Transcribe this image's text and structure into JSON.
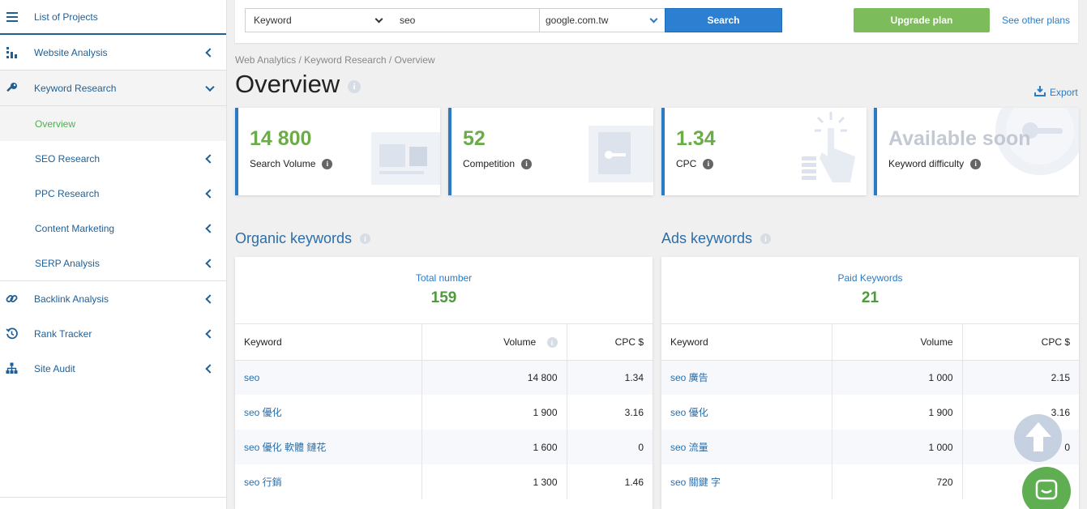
{
  "sidebar": {
    "top_item": {
      "label": "List of Projects",
      "icon": "menu-icon"
    },
    "items": [
      {
        "label": "Website Analysis",
        "icon": "bar-chart-icon"
      },
      {
        "label": "Keyword Research",
        "icon": "key-icon"
      }
    ],
    "sub_items": [
      {
        "label": "Overview"
      },
      {
        "label": "SEO Research"
      },
      {
        "label": "PPC Research"
      },
      {
        "label": "Content Marketing"
      },
      {
        "label": "SERP Analysis"
      }
    ],
    "bottom_items": [
      {
        "label": "Backlink Analysis",
        "icon": "link-icon"
      },
      {
        "label": "Rank Tracker",
        "icon": "history-icon"
      },
      {
        "label": "Site Audit",
        "icon": "sitemap-icon"
      }
    ]
  },
  "search": {
    "type_value": "Keyword",
    "query_value": "seo",
    "engine_value": "google.com.tw",
    "search_label": "Search",
    "upgrade_label": "Upgrade plan",
    "plans_label": "See other plans"
  },
  "breadcrumb": "Web Analytics / Keyword Research / Overview",
  "page_title": "Overview",
  "export_label": "Export",
  "metrics": [
    {
      "value": "14 800",
      "label": "Search Volume"
    },
    {
      "value": "52",
      "label": "Competition"
    },
    {
      "value": "1.34",
      "label": "CPC"
    },
    {
      "value": "Available soon",
      "label": "Keyword difficulty"
    }
  ],
  "organic": {
    "title": "Organic keywords",
    "total_label": "Total number",
    "total_value": "159",
    "columns": [
      "Keyword",
      "Volume",
      "CPC $"
    ],
    "rows": [
      {
        "keyword": "seo",
        "volume": "14 800",
        "cpc": "1.34"
      },
      {
        "keyword": "seo 優化",
        "volume": "1 900",
        "cpc": "3.16"
      },
      {
        "keyword": "seo 優化 軟體 鏈花",
        "volume": "1 600",
        "cpc": "0"
      },
      {
        "keyword": "seo 行銷",
        "volume": "1 300",
        "cpc": "1.46"
      }
    ]
  },
  "ads": {
    "title": "Ads keywords",
    "total_label": "Paid Keywords",
    "total_value": "21",
    "columns": [
      "Keyword",
      "Volume",
      "CPC $"
    ],
    "rows": [
      {
        "keyword": "seo 廣告",
        "volume": "1 000",
        "cpc": "2.15"
      },
      {
        "keyword": "seo 優化",
        "volume": "1 900",
        "cpc": "3.16"
      },
      {
        "keyword": "seo 流量",
        "volume": "1 000",
        "cpc": "0"
      },
      {
        "keyword": "seo 關鍵 字",
        "volume": "720",
        "cpc": ""
      }
    ]
  },
  "colors": {
    "accent": "#2b7bc4",
    "green": "#6cab4a",
    "upgrade": "#7cbc5a"
  }
}
